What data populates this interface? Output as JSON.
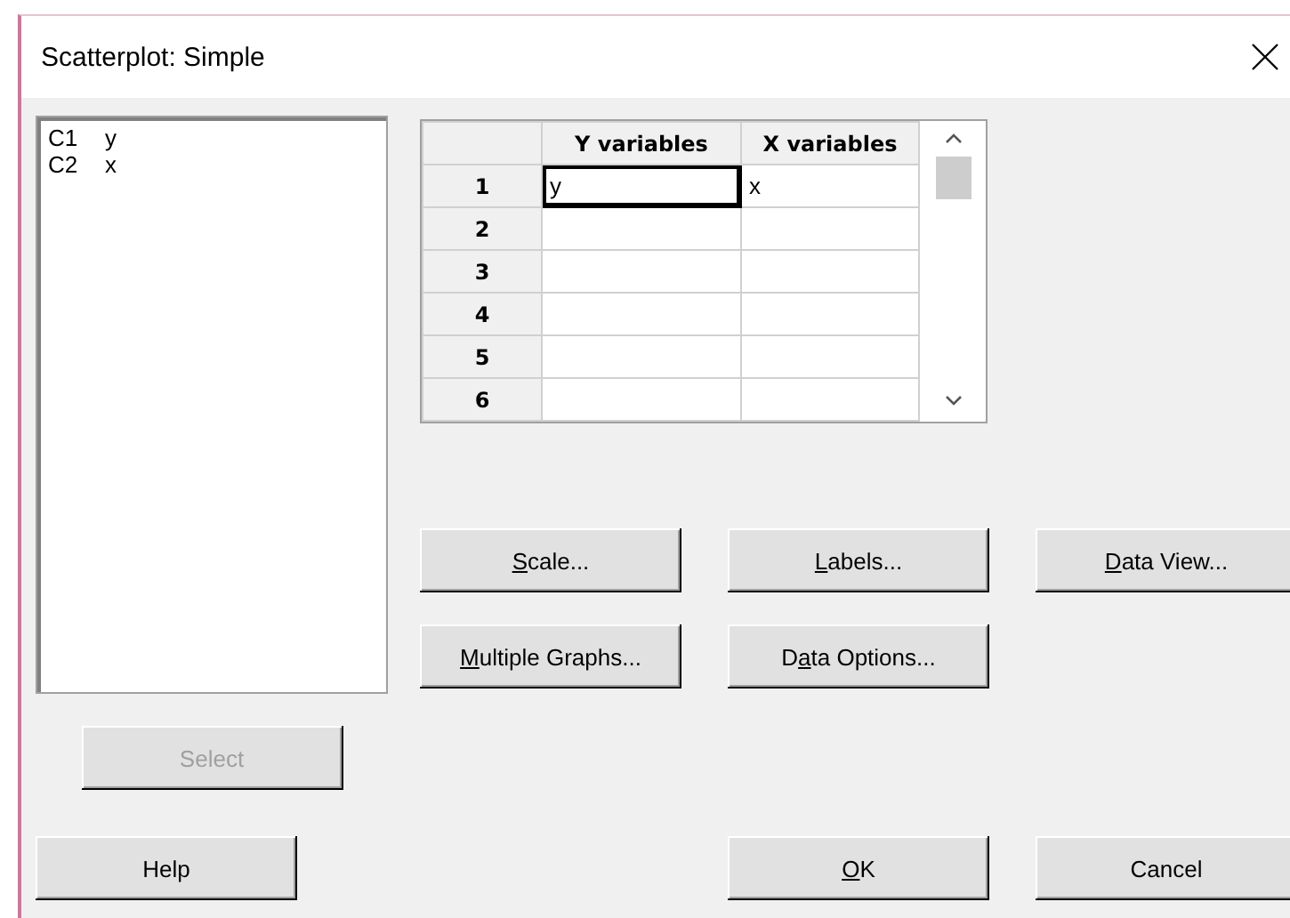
{
  "window": {
    "title": "Scatterplot: Simple"
  },
  "variables_list": [
    {
      "column": "C1",
      "name": "y"
    },
    {
      "column": "C2",
      "name": "x"
    }
  ],
  "grid": {
    "columns": [
      "Y variables",
      "X variables"
    ],
    "rows": [
      {
        "number": "1",
        "cells": [
          {
            "value": "y",
            "selected": true
          },
          {
            "value": "x",
            "selected": false
          }
        ]
      },
      {
        "number": "2",
        "cells": [
          {
            "selected": false
          },
          {
            "selected": false
          }
        ]
      },
      {
        "number": "3",
        "cells": [
          {
            "selected": false
          },
          {
            "selected": false
          }
        ]
      },
      {
        "number": "4",
        "cells": [
          {
            "selected": false
          },
          {
            "selected": false
          }
        ]
      },
      {
        "number": "5",
        "cells": [
          {
            "selected": false
          },
          {
            "selected": false
          }
        ]
      },
      {
        "number": "6",
        "cells": [
          {
            "selected": false
          },
          {
            "selected": false
          }
        ]
      }
    ]
  },
  "buttons": [
    {
      "access_key": "S",
      "label_rest": "cale...",
      "disabled": false
    },
    {
      "access_key": "L",
      "label_rest": "abels...",
      "disabled": false
    },
    {
      "access_key": "D",
      "label_rest": "ata View...",
      "disabled": false
    },
    {
      "access_key": "M",
      "label_rest": "ultiple Graphs...",
      "disabled": false
    },
    {
      "label_start": "D",
      "access_key": "a",
      "label_rest": "ta Options...",
      "disabled": false
    },
    {
      "label": "Select",
      "disabled": true
    },
    {
      "label": "Help",
      "disabled": false
    },
    {
      "access_key": "O",
      "label_rest": "K",
      "disabled": false
    },
    {
      "label": "Cancel",
      "disabled": false
    }
  ]
}
